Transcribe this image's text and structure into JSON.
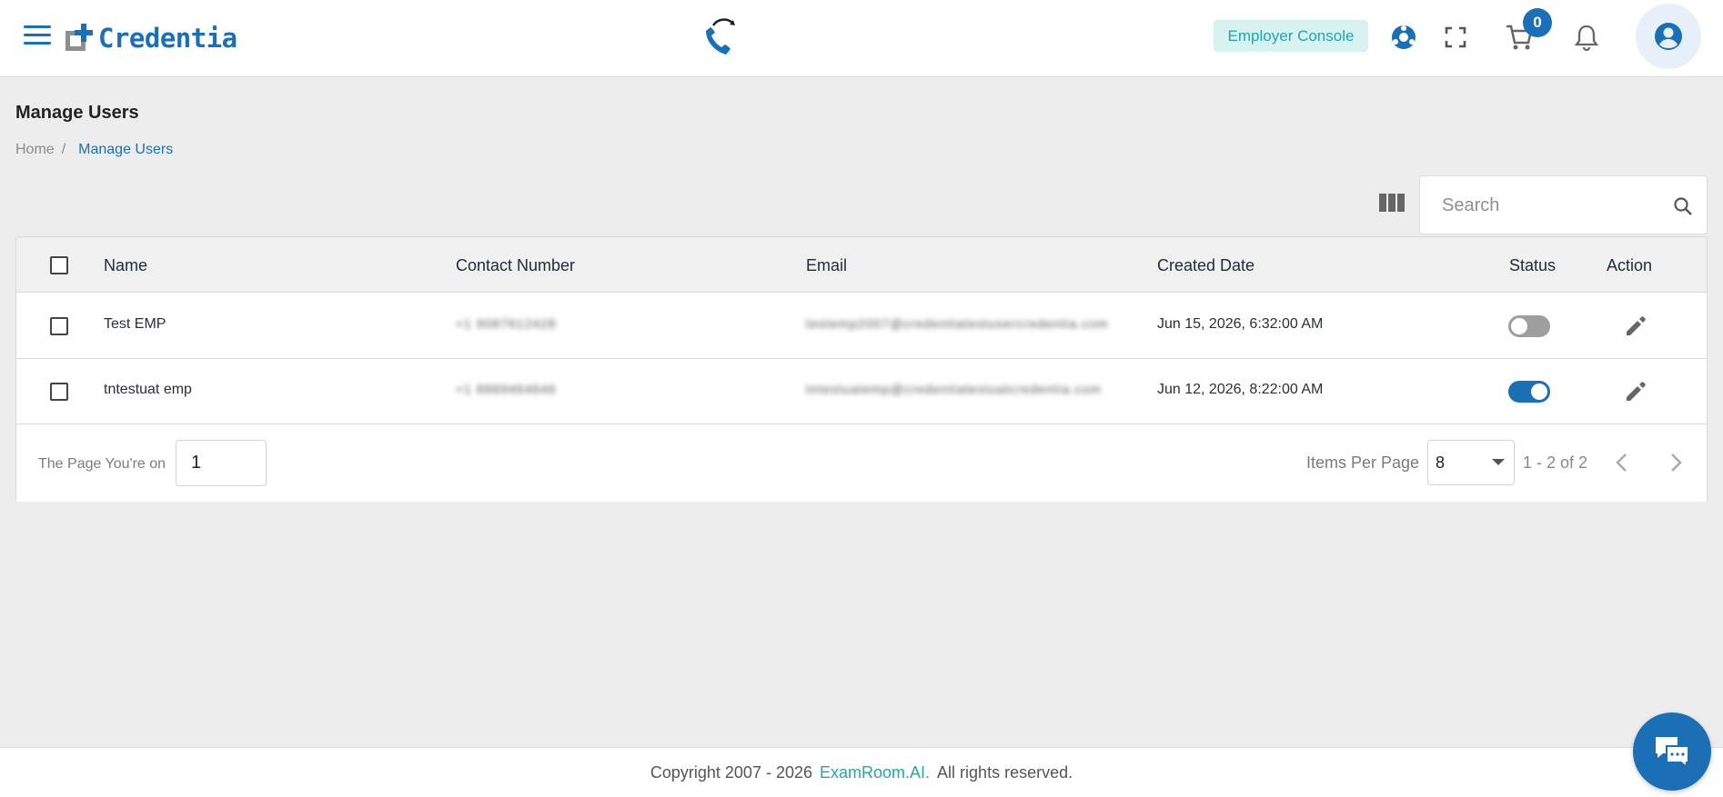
{
  "header": {
    "logo_text": "Credentia",
    "employer_console_label": "Employer Console",
    "cart_count": "0"
  },
  "page": {
    "title": "Manage Users",
    "breadcrumb": {
      "home": "Home",
      "separator": "/",
      "current": "Manage Users"
    }
  },
  "search": {
    "placeholder": "Search"
  },
  "table": {
    "columns": [
      "Name",
      "Contact Number",
      "Email",
      "Created Date",
      "Status",
      "Action"
    ],
    "rows": [
      {
        "name": "Test EMP",
        "contact": "+1 9087612428",
        "email": "testemp2007@credentiatestusercredentia.com",
        "created": "Jun 15, 2026, 6:32:00 AM",
        "status_active": false
      },
      {
        "name": "tntestuat emp",
        "contact": "+1 8889464646",
        "email": "tntestuatemp@credentiatestuatcredentia.com",
        "created": "Jun 12, 2026, 8:22:00 AM",
        "status_active": true
      }
    ]
  },
  "pagination": {
    "page_label": "The Page You're on",
    "page_value": "1",
    "items_per_page_label": "Items Per Page",
    "items_per_page_value": "8",
    "range_text": "1 - 2 of 2"
  },
  "footer": {
    "copyright_prefix": "Copyright 2007 - 2026",
    "brand": "ExamRoom.AI.",
    "suffix": "All rights reserved."
  },
  "colors": {
    "primary": "#1b6fb5",
    "accent_teal": "#22a6ad",
    "background": "#ededed"
  },
  "icons": [
    "menu-icon",
    "headset-icon",
    "globe-icon",
    "fullscreen-icon",
    "cart-icon",
    "bell-icon",
    "user-circle-icon",
    "columns-icon",
    "search-icon",
    "edit-icon",
    "chevron-left-icon",
    "chevron-right-icon",
    "chat-icon"
  ]
}
